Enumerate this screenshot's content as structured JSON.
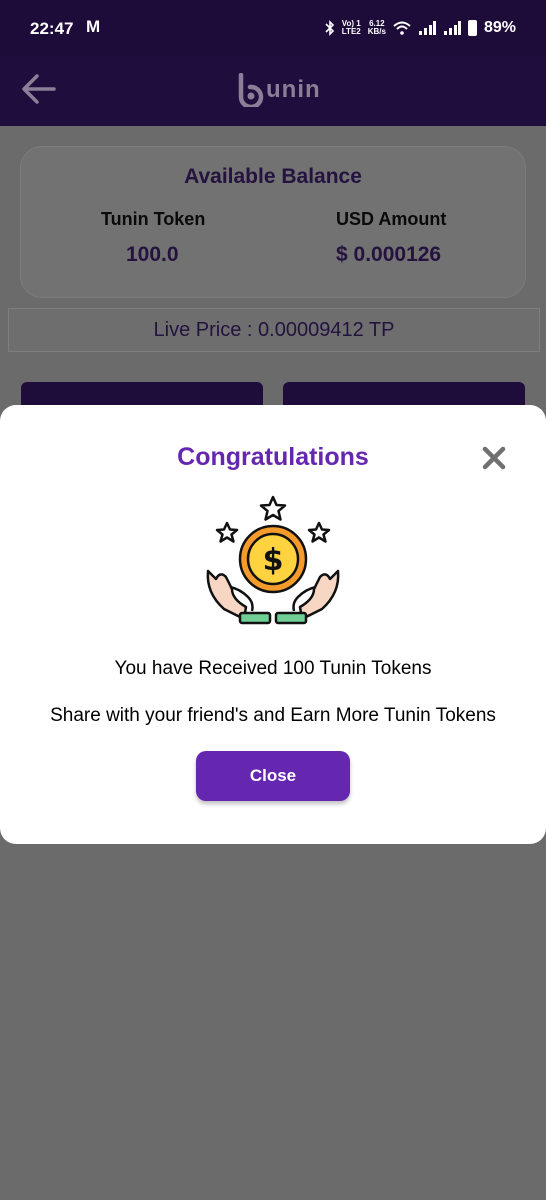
{
  "status_bar": {
    "time": "22:47",
    "mail_icon": "M",
    "network_top": "Vo) 1",
    "network_bottom": "LTE2",
    "speed_top": "6.12",
    "speed_bottom": "KB/s",
    "battery_percent": "89%"
  },
  "app_bar": {
    "back_icon": "arrow-left-icon",
    "logo_text": "unin"
  },
  "balance": {
    "title": "Available Balance",
    "token_label": "Tunin Token",
    "token_value": "100.0",
    "usd_label": "USD Amount",
    "usd_value": "$ 0.000126"
  },
  "live_price": "Live Price : 0.00009412 TP",
  "modal": {
    "title": "Congratulations",
    "message_received": "You have Received 100 Tunin Tokens",
    "message_share": "Share with your friend's and Earn More Tunin Tokens",
    "close_button_label": "Close",
    "illustration_icon": "coin-hands-stars-icon"
  },
  "colors": {
    "status_bar_bg": "#1d0b3a",
    "app_bar_bg": "#1f0d3d",
    "overlay_bg": "#6b6b6b",
    "accent_purple": "#6527b0"
  }
}
